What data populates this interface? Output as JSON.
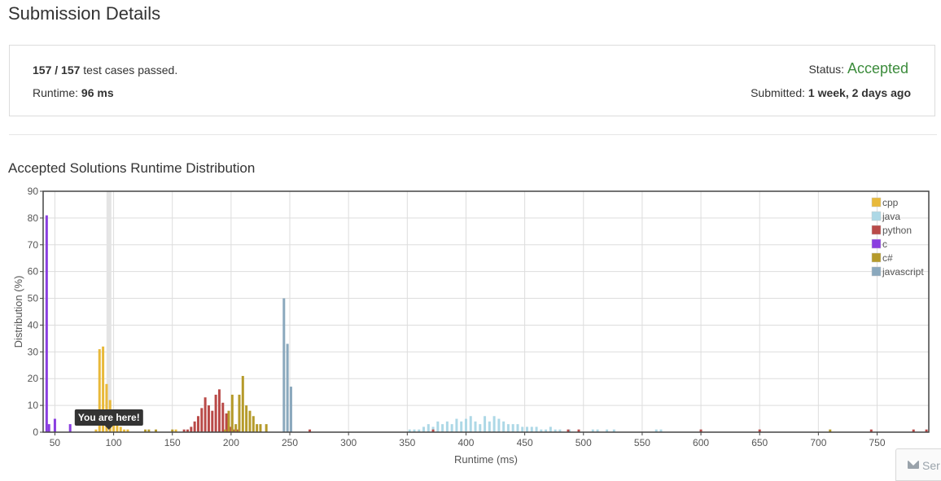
{
  "page": {
    "title": "Submission Details"
  },
  "summary": {
    "passed": "157",
    "slash": " / ",
    "total": "157",
    "passed_suffix": " test cases passed.",
    "runtime_label": "Runtime: ",
    "runtime_value": "96 ms",
    "status_label": "Status: ",
    "status_value": "Accepted",
    "submitted_label": "Submitted: ",
    "submitted_value": "1 week, 2 days ago"
  },
  "chart_section": {
    "title": "Accepted Solutions Runtime Distribution"
  },
  "colors": {
    "cpp": "#e8b93a",
    "java": "#add8e6",
    "python": "#b94a48",
    "c": "#8a3ee0",
    "csharp": "#b59a2a",
    "javascript": "#8aa8bd",
    "accent_status": "#3c8c3c"
  },
  "bottom_widget": {
    "icon": "mail-icon",
    "label": "Ser"
  },
  "chart_data": {
    "type": "bar",
    "title": "Accepted Solutions Runtime Distribution",
    "xlabel": "Runtime (ms)",
    "ylabel": "Distribution (%)",
    "xlim": [
      40,
      794
    ],
    "ylim": [
      0,
      90
    ],
    "xticks": [
      50,
      100,
      150,
      200,
      250,
      300,
      350,
      400,
      450,
      500,
      550,
      600,
      650,
      700,
      750
    ],
    "yticks": [
      0,
      10,
      20,
      30,
      40,
      50,
      60,
      70,
      80,
      90
    ],
    "grid": true,
    "legend_position": "top-right",
    "marker": {
      "x": 96,
      "label": "You are here!"
    },
    "series": [
      {
        "name": "cpp",
        "color": "#e8b93a",
        "points": [
          [
            85,
            1
          ],
          [
            88,
            31
          ],
          [
            91,
            32
          ],
          [
            94,
            18
          ],
          [
            97,
            12
          ],
          [
            100,
            6
          ],
          [
            103,
            4
          ],
          [
            106,
            2
          ],
          [
            109,
            1
          ],
          [
            112,
            1
          ],
          [
            153,
            1
          ]
        ]
      },
      {
        "name": "java",
        "color": "#add8e6",
        "points": [
          [
            352,
            1
          ],
          [
            356,
            1
          ],
          [
            360,
            1
          ],
          [
            364,
            2
          ],
          [
            368,
            3
          ],
          [
            372,
            2
          ],
          [
            376,
            4
          ],
          [
            380,
            3
          ],
          [
            384,
            4
          ],
          [
            388,
            3
          ],
          [
            392,
            5
          ],
          [
            396,
            4
          ],
          [
            400,
            5
          ],
          [
            404,
            6
          ],
          [
            408,
            4
          ],
          [
            412,
            3
          ],
          [
            416,
            6
          ],
          [
            420,
            4
          ],
          [
            424,
            6
          ],
          [
            428,
            5
          ],
          [
            432,
            4
          ],
          [
            436,
            3
          ],
          [
            440,
            3
          ],
          [
            444,
            3
          ],
          [
            448,
            2
          ],
          [
            452,
            2
          ],
          [
            456,
            2
          ],
          [
            460,
            2
          ],
          [
            464,
            1
          ],
          [
            468,
            1
          ],
          [
            472,
            2
          ],
          [
            476,
            1
          ],
          [
            480,
            1
          ],
          [
            488,
            1
          ],
          [
            508,
            1
          ],
          [
            512,
            1
          ],
          [
            520,
            1
          ],
          [
            526,
            1
          ],
          [
            562,
            1
          ],
          [
            566,
            1
          ]
        ]
      },
      {
        "name": "python",
        "color": "#b94a48",
        "points": [
          [
            160,
            1
          ],
          [
            163,
            1
          ],
          [
            166,
            2
          ],
          [
            169,
            4
          ],
          [
            172,
            6
          ],
          [
            175,
            9
          ],
          [
            178,
            13
          ],
          [
            181,
            10
          ],
          [
            184,
            8
          ],
          [
            187,
            14
          ],
          [
            190,
            16
          ],
          [
            193,
            11
          ],
          [
            196,
            7
          ],
          [
            199,
            2
          ],
          [
            202,
            1
          ],
          [
            205,
            1
          ],
          [
            267,
            1
          ],
          [
            372,
            1
          ],
          [
            487,
            1
          ],
          [
            496,
            1
          ],
          [
            600,
            1
          ],
          [
            650,
            1
          ],
          [
            745,
            1
          ],
          [
            781,
            1
          ],
          [
            792,
            1
          ]
        ]
      },
      {
        "name": "c",
        "color": "#8a3ee0",
        "points": [
          [
            43,
            81
          ],
          [
            45,
            3
          ],
          [
            50,
            5
          ],
          [
            63,
            3
          ]
        ]
      },
      {
        "name": "c#",
        "color": "#b59a2a",
        "points": [
          [
            127,
            1
          ],
          [
            130,
            1
          ],
          [
            136,
            1
          ],
          [
            150,
            1
          ],
          [
            195,
            1
          ],
          [
            198,
            8
          ],
          [
            201,
            14
          ],
          [
            204,
            3
          ],
          [
            207,
            14
          ],
          [
            210,
            21
          ],
          [
            213,
            10
          ],
          [
            216,
            8
          ],
          [
            219,
            6
          ],
          [
            222,
            3
          ],
          [
            225,
            3
          ],
          [
            230,
            3
          ],
          [
            710,
            1
          ]
        ]
      },
      {
        "name": "javascript",
        "color": "#8aa8bd",
        "points": [
          [
            245,
            50
          ],
          [
            248,
            33
          ],
          [
            251,
            17
          ]
        ]
      }
    ]
  }
}
